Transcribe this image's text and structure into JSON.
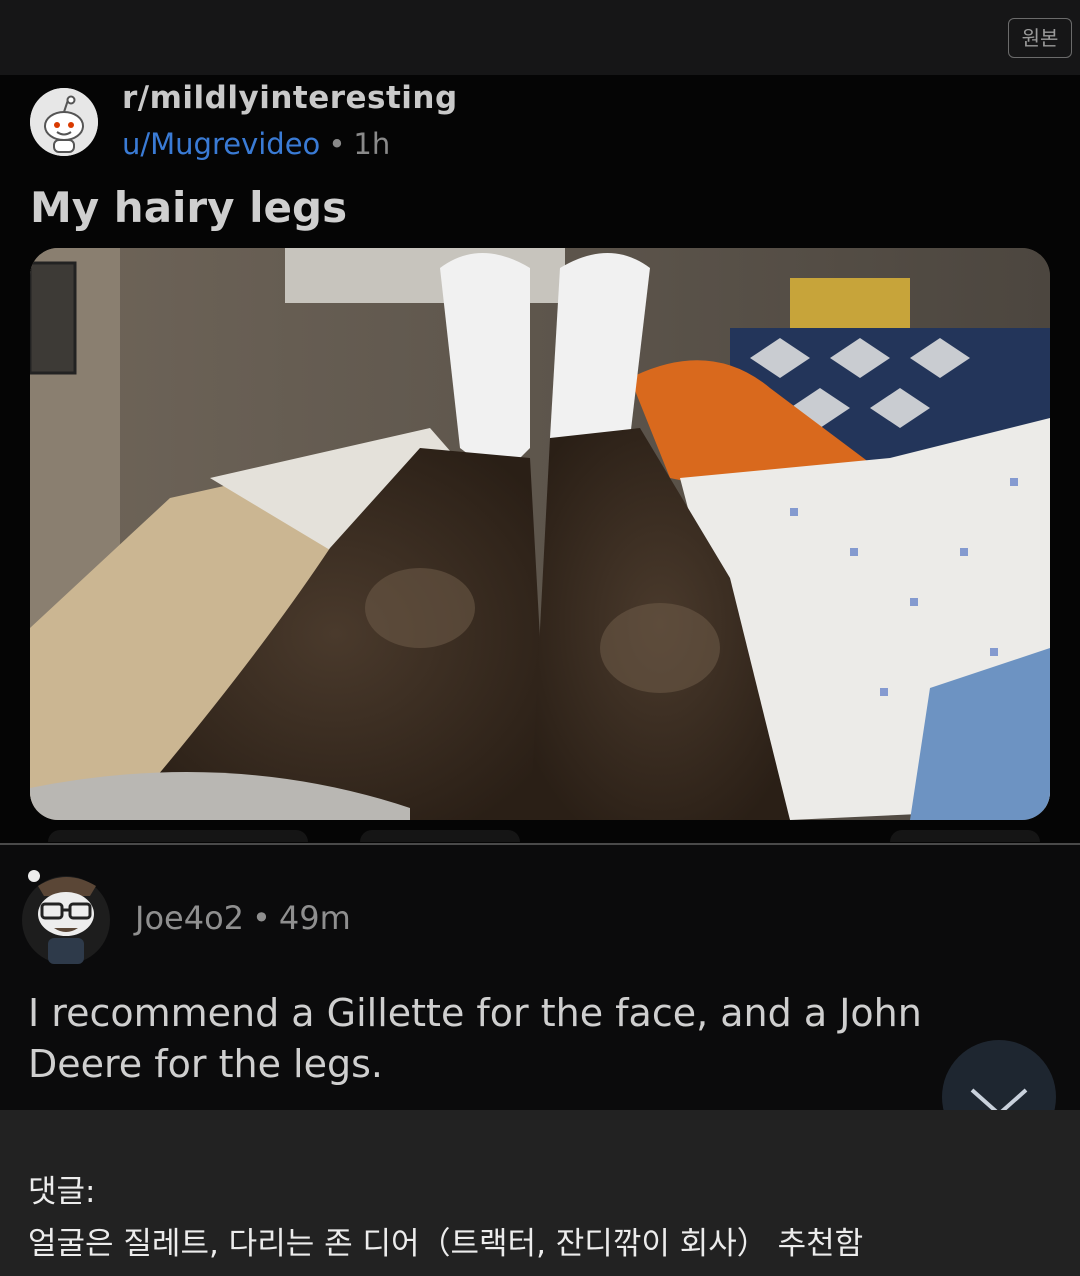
{
  "topbar": {
    "original_button_label": "원본"
  },
  "post": {
    "subreddit": "r/mildlyinteresting",
    "username": "u/Mugrevideo",
    "separator": "•",
    "age": "1h",
    "title": "My hairy legs"
  },
  "comment": {
    "username": "Joe4o2",
    "separator": "•",
    "age": "49m",
    "text": "I recommend a Gillette for the face, and a John Deere for the legs."
  },
  "caption": {
    "label": "댓글:",
    "text": "얼굴은 질레트, 다리는 존 디어（트랙터, 잔디깎이 회사） 추천함"
  },
  "colors": {
    "background": "#0b0b0c",
    "username_link": "#3a7bd5",
    "caption_panel": "#222222"
  }
}
